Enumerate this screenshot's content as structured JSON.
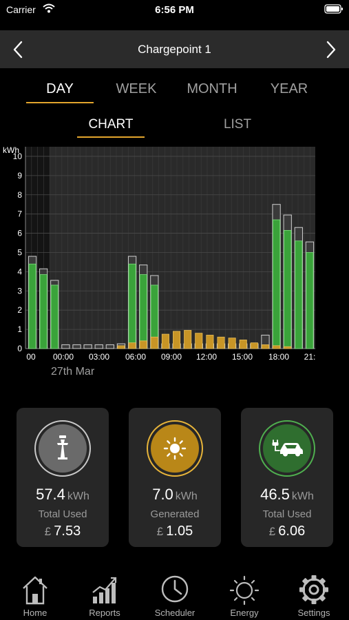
{
  "status_bar": {
    "carrier": "Carrier",
    "time": "6:56 PM"
  },
  "header": {
    "title": "Chargepoint 1",
    "prev_icon": "chevron-left-icon",
    "next_icon": "chevron-right-icon"
  },
  "period_tabs": [
    {
      "label": "DAY",
      "active": true
    },
    {
      "label": "WEEK",
      "active": false
    },
    {
      "label": "MONTH",
      "active": false
    },
    {
      "label": "YEAR",
      "active": false
    }
  ],
  "view_tabs": [
    {
      "label": "CHART",
      "active": true
    },
    {
      "label": "LIST",
      "active": false
    }
  ],
  "colors": {
    "accent": "#e3a52d",
    "used": "#3aa33a",
    "generated": "#c89526",
    "gray_bar": "#3a3a3a"
  },
  "chart_data": {
    "type": "bar",
    "ylabel": "kWh",
    "ylim": [
      0,
      10.5
    ],
    "yticks": [
      0,
      1,
      2,
      3,
      4,
      5,
      6,
      7,
      8,
      9,
      10
    ],
    "xtick_labels": [
      "00",
      "00:00",
      "03:00",
      "06:00",
      "09:00",
      "12:00",
      "15:00",
      "18:00",
      "21:"
    ],
    "date_label": "27th Mar",
    "series": [
      {
        "key": "total",
        "values": [
          4.8,
          4.15,
          3.55,
          0.2,
          0.2,
          0.2,
          0.2,
          0.2,
          0.25,
          4.8,
          4.35,
          3.8,
          0.25,
          0.25,
          0.25,
          0.25,
          0.25,
          0.25,
          0.25,
          0.25,
          0.25,
          0.7,
          7.5,
          6.95,
          6.3,
          5.55
        ]
      },
      {
        "key": "used",
        "values": [
          4.4,
          3.85,
          3.3,
          0,
          0,
          0,
          0,
          0,
          0,
          4.4,
          3.85,
          3.3,
          0,
          0,
          0,
          0,
          0,
          0,
          0,
          0,
          0,
          0,
          6.7,
          6.15,
          5.6,
          5.0
        ]
      },
      {
        "key": "generated",
        "values": [
          0,
          0,
          0,
          0,
          0,
          0,
          0,
          0,
          0.15,
          0.3,
          0.4,
          0.6,
          0.75,
          0.9,
          0.95,
          0.8,
          0.7,
          0.6,
          0.55,
          0.45,
          0.3,
          0.2,
          0.15,
          0.1,
          0,
          0
        ]
      }
    ]
  },
  "stats": [
    {
      "icon": "pylon-icon",
      "value": "57.4",
      "unit": "kWh",
      "label": "Total Used",
      "currency": "£",
      "cost": "7.53"
    },
    {
      "icon": "sun-icon",
      "value": "7.0",
      "unit": "kWh",
      "label": "Generated",
      "currency": "£",
      "cost": "1.05"
    },
    {
      "icon": "car-icon",
      "value": "46.5",
      "unit": "kWh",
      "label": "Total Used",
      "currency": "£",
      "cost": "6.06"
    }
  ],
  "tab_bar": [
    {
      "label": "Home",
      "icon": "home-icon"
    },
    {
      "label": "Reports",
      "icon": "reports-icon"
    },
    {
      "label": "Scheduler",
      "icon": "clock-icon"
    },
    {
      "label": "Energy",
      "icon": "energy-sun-icon"
    },
    {
      "label": "Settings",
      "icon": "gear-icon"
    }
  ]
}
